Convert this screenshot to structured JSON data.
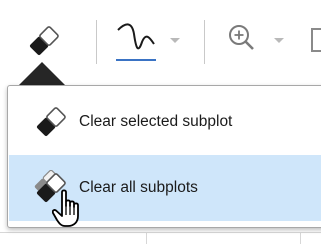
{
  "toolbar": {
    "buttons": [
      {
        "name": "clear-button",
        "icon": "eraser-icon"
      },
      {
        "name": "basic-fitting-button",
        "icon": "curve-icon"
      },
      {
        "name": "zoom-in-button",
        "icon": "zoom-in-icon"
      }
    ]
  },
  "menu": {
    "items": [
      {
        "label": "Clear selected subplot",
        "icon": "eraser-icon",
        "selected": false
      },
      {
        "label": "Clear all subplots",
        "icon": "eraser-stack-icon",
        "selected": true
      }
    ]
  },
  "colors": {
    "highlight": "#cfe6fa",
    "eraser_tip": "#1a1a1a",
    "curve_blue": "#3a73c4"
  }
}
